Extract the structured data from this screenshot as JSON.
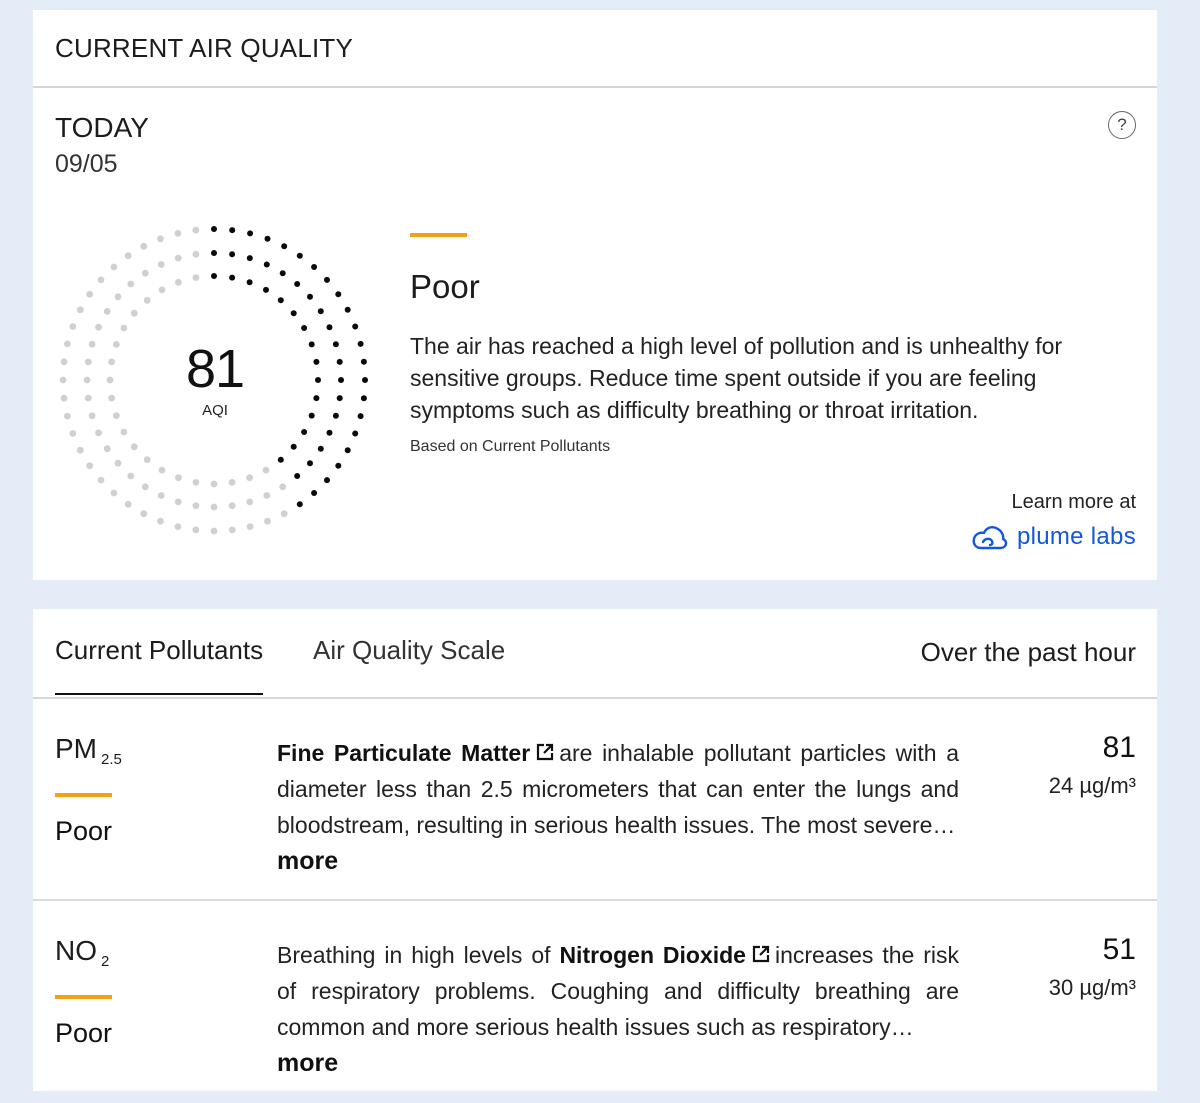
{
  "header": {
    "title": "CURRENT AIR QUALITY"
  },
  "today": {
    "label": "TODAY",
    "date": "09/05",
    "help_icon": "?"
  },
  "aqi": {
    "value": "81",
    "unit": "AQI",
    "level_fraction": 0.405,
    "level": "Poor",
    "level_color": "#f2a114",
    "description": "The air has reached a high level of pollution and is unhealthy for sensitive groups. Reduce time spent outside if you are feeling symptoms such as difficulty breathing or throat irritation.",
    "based_on": "Based on Current Pollutants"
  },
  "source": {
    "learn_more": "Learn more at",
    "brand": "plume labs",
    "brand_icon": "cloud-icon",
    "brand_color": "#1457d8"
  },
  "tabs": {
    "current": "Current Pollutants",
    "scale": "Air Quality Scale",
    "period": "Over the past hour"
  },
  "pollutants": [
    {
      "name": "PM",
      "subscript": "2.5",
      "level": "Poor",
      "title": "Fine Particulate Matter",
      "text_after": "are inhalable pollutant particles with a diameter less than 2.5 micrometers that can enter the lungs and bloodstream, resulting in serious health issues. The most severe…",
      "more": "more",
      "value": "81",
      "concentration": "24 µg/m³"
    },
    {
      "name": "NO",
      "subscript": "2",
      "level": "Poor",
      "text_before": "Breathing in high levels of",
      "title": "Nitrogen Dioxide",
      "text_after": "increases the risk of respiratory problems. Coughing and difficulty breathing are common and more serious health issues such as respiratory…",
      "more": "more",
      "value": "51",
      "concentration": "30 µg/m³"
    }
  ]
}
